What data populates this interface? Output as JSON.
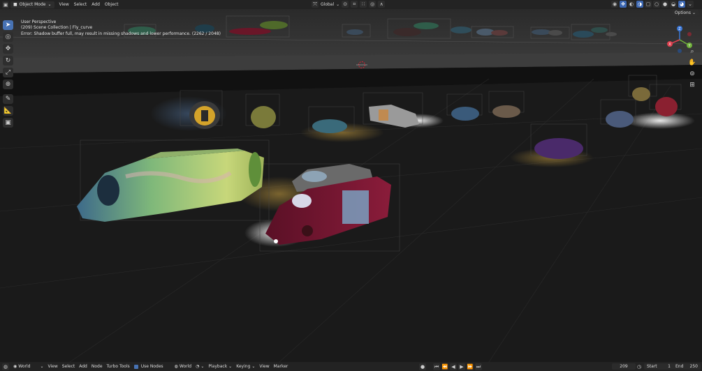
{
  "topbar": {
    "mode": "Object Mode",
    "menus": [
      "View",
      "Select",
      "Add",
      "Object"
    ],
    "transform_orientation": "Global"
  },
  "viewport": {
    "overlay": {
      "perspective": "User Perspective",
      "collection": "(209) Scene Collection | Fly_curve",
      "error": "Error: Shadow buffer full, may result in missing shadows and lower performance. (2262 / 2048)"
    },
    "options_label": "Options",
    "gizmo_axes": {
      "x": "X",
      "y": "Y",
      "z": "Z"
    }
  },
  "timeline": {
    "editor": "World",
    "menus": [
      "View",
      "Select",
      "Add",
      "Node",
      "Turbo Tools"
    ],
    "use_nodes_label": "Use Nodes",
    "world_label": "World",
    "playback_label": "Playback",
    "keying_label": "Keying",
    "view_label": "View",
    "marker_label": "Marker",
    "current_frame": "209",
    "start_label": "Start",
    "start_value": "1",
    "end_label": "End",
    "end_value": "250"
  },
  "colors": {
    "accent": "#4772b3",
    "axis_x": "#e0404f",
    "axis_y": "#6fb03a",
    "axis_z": "#3b77d6"
  }
}
